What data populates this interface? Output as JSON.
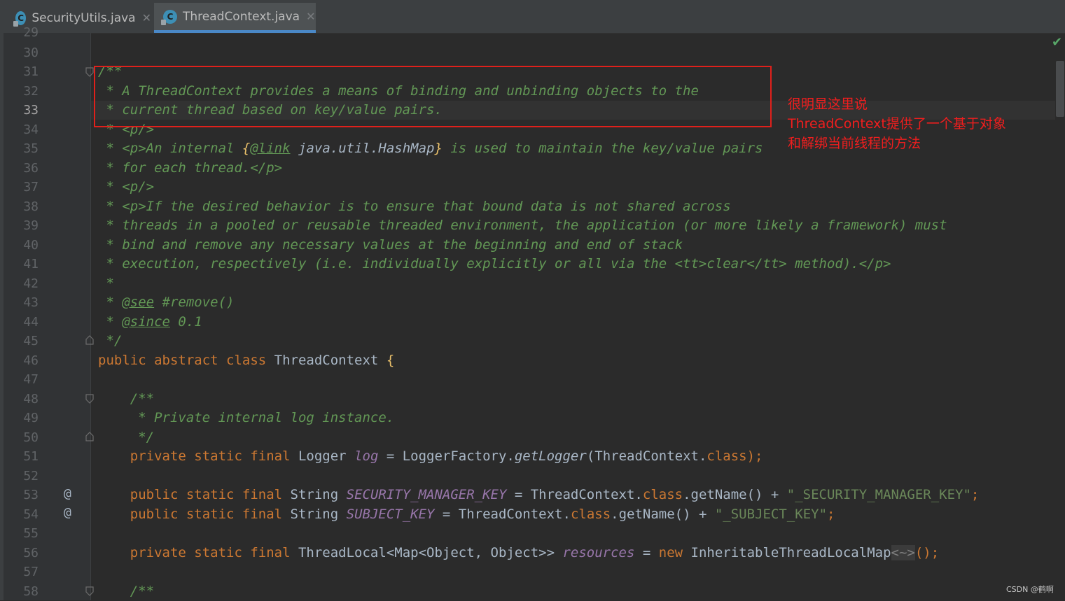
{
  "tabs": [
    {
      "label": "SecurityUtils.java",
      "icon": "java-class-icon"
    },
    {
      "label": "ThreadContext.java",
      "icon": "java-class-icon",
      "active": true
    }
  ],
  "status": {
    "check": "✔"
  },
  "watermark": "CSDN @鹤啊",
  "annotation": {
    "lines": [
      "很明显这里说",
      "ThreadContext提供了一个基于对象",
      "和解绑当前线程的方法"
    ],
    "color": "#f01e1e"
  },
  "editor": {
    "current_line": 33,
    "top_partial_line": "29",
    "line_numbers": [
      "30",
      "31",
      "32",
      "33",
      "34",
      "35",
      "36",
      "37",
      "38",
      "39",
      "40",
      "41",
      "42",
      "43",
      "44",
      "45",
      "46",
      "47",
      "48",
      "49",
      "50",
      "51",
      "52",
      "53",
      "54",
      "55",
      "56",
      "57",
      "58"
    ],
    "gutter_marks": {
      "53": "@",
      "54": "@"
    },
    "code": {
      "l31": "/**",
      "l32": " * A ThreadContext provides a means of binding and unbinding objects to the",
      "l33": " * current thread based on key/value pairs.",
      "l34": " * <p/>",
      "l35a": " * <p>An internal ",
      "l35b": "{",
      "l35c": "@link",
      "l35d": " java.util.HashMap",
      "l35e": "}",
      "l35f": " is used to maintain the key/value pairs",
      "l36": " * for each thread.</p>",
      "l37": " * <p/>",
      "l38": " * <p>If the desired behavior is to ensure that bound data is not shared across",
      "l39": " * threads in a pooled or reusable threaded environment, the application (or more likely a framework) must",
      "l40": " * bind and remove any necessary values at the beginning and end of stack",
      "l41": " * execution, respectively (i.e. individually explicitly or all via the <tt>clear</tt> method).</p>",
      "l42": " *",
      "l43a": " * ",
      "l43b": "@see",
      "l43c": " #remove()",
      "l44a": " * ",
      "l44b": "@since",
      "l44c": " 0.1",
      "l45": " */",
      "l46a": "public abstract class",
      "l46b": " ThreadContext ",
      "l46c": "{",
      "l48": "    /**",
      "l49": "     * Private internal log instance.",
      "l50": "     */",
      "l51a": "    private static final",
      "l51b": " Logger ",
      "l51c": "log",
      "l51d": " = LoggerFactory.",
      "l51e": "getLogger",
      "l51f": "(ThreadContext.",
      "l51g": "class",
      "l51h": ");",
      "l53a": "    public static final",
      "l53b": " String ",
      "l53c": "SECURITY_MANAGER_KEY",
      "l53d": " = ThreadContext.",
      "l53e": "class",
      "l53f": ".getName() + ",
      "l53g": "\"_SECURITY_MANAGER_KEY\"",
      "l53h": ";",
      "l54a": "    public static final",
      "l54b": " String ",
      "l54c": "SUBJECT_KEY",
      "l54d": " = ThreadContext.",
      "l54e": "class",
      "l54f": ".getName() + ",
      "l54g": "\"_SUBJECT_KEY\"",
      "l54h": ";",
      "l56a": "    private static final",
      "l56b": " ThreadLocal<Map<Object, Object>> ",
      "l56c": "resources",
      "l56d": " = ",
      "l56e": "new",
      "l56f": " InheritableThreadLocalMap",
      "l56g": "<~>",
      "l56h": "();",
      "l58": "    /**"
    }
  }
}
